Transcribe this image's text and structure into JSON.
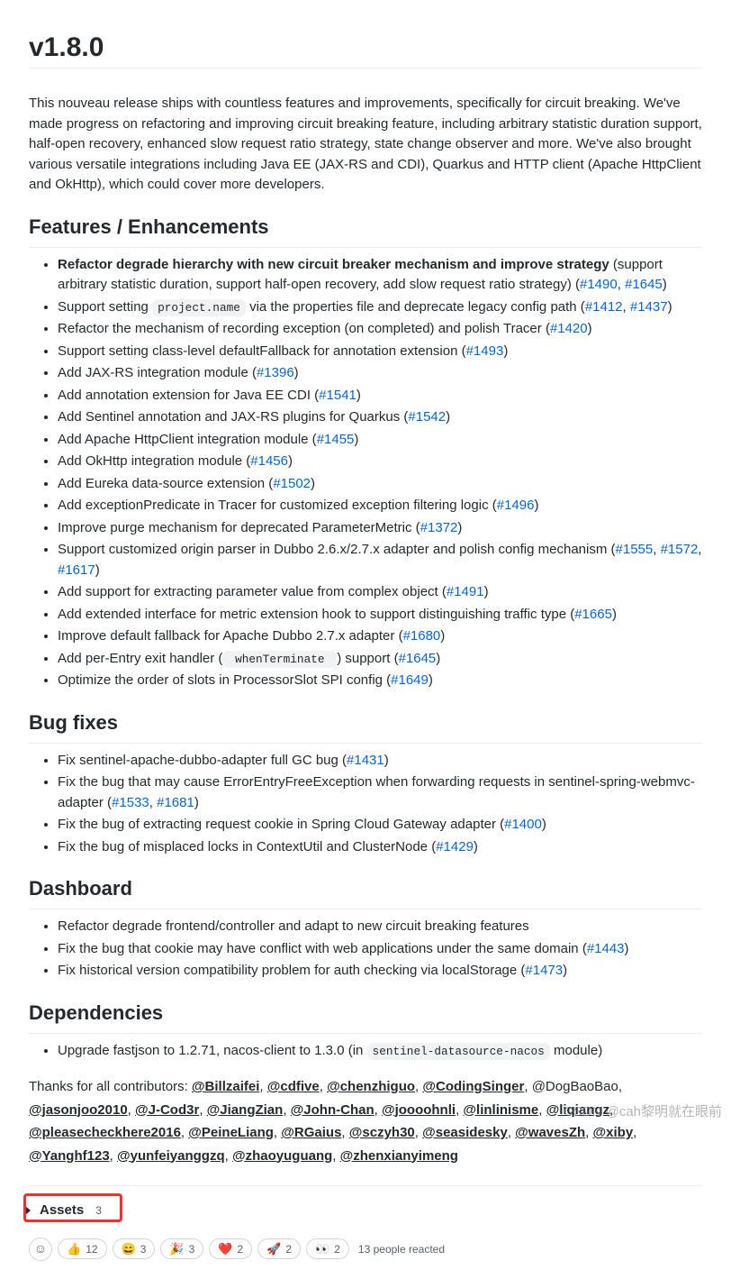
{
  "title": "v1.8.0",
  "intro": "This nouveau release ships with countless features and improvements, specifically for circuit breaking. We've made progress on refactoring and improving circuit breaking feature, including arbitrary statistic duration support, half-open recovery, enhanced slow request ratio strategy, state change observer and more. We've also brought various versatile integrations including Java EE (JAX-RS and CDI), Quarkus and HTTP client (Apache HttpClient and OkHttp), which could cover more developers.",
  "sections": {
    "features": {
      "heading": "Features / Enhancements",
      "items": [
        {
          "bold": "Refactor degrade hierarchy with new circuit breaker mechanism and improve strategy",
          "rest": " (support arbitrary statistic duration, support half-open recovery, add slow request ratio strategy) (",
          "links": [
            "#1490",
            "#1645"
          ],
          "tail": ")"
        },
        {
          "pre": "Support setting ",
          "code": "project.name",
          "rest": " via the properties file and deprecate legacy config path (",
          "links": [
            "#1412",
            "#1437"
          ],
          "tail": ")"
        },
        {
          "pre": "Refactor the mechanism of recording exception (on completed) and polish Tracer (",
          "links": [
            "#1420"
          ],
          "tail": ")"
        },
        {
          "pre": "Support setting class-level defaultFallback for annotation extension (",
          "links": [
            "#1493"
          ],
          "tail": ")"
        },
        {
          "pre": "Add JAX-RS integration module (",
          "links": [
            "#1396"
          ],
          "tail": ")"
        },
        {
          "pre": "Add annotation extension for Java EE CDI (",
          "links": [
            "#1541"
          ],
          "tail": ")"
        },
        {
          "pre": "Add Sentinel annotation and JAX-RS plugins for Quarkus (",
          "links": [
            "#1542"
          ],
          "tail": ")"
        },
        {
          "pre": "Add Apache HttpClient integration module (",
          "links": [
            "#1455"
          ],
          "tail": ")"
        },
        {
          "pre": "Add OkHttp integration module (",
          "links": [
            "#1456"
          ],
          "tail": ")"
        },
        {
          "pre": "Add Eureka data-source extension (",
          "links": [
            "#1502"
          ],
          "tail": ")"
        },
        {
          "pre": "Add exceptionPredicate in Tracer for customized exception filtering logic (",
          "links": [
            "#1496"
          ],
          "tail": ")"
        },
        {
          "pre": "Improve purge mechanism for deprecated ParameterMetric (",
          "links": [
            "#1372"
          ],
          "tail": ")"
        },
        {
          "pre": "Support customized origin parser in Dubbo 2.6.x/2.7.x adapter and polish config mechanism (",
          "links": [
            "#1555",
            "#1572",
            "#1617"
          ],
          "tail": ")"
        },
        {
          "pre": "Add support for extracting parameter value from complex object (",
          "links": [
            "#1491"
          ],
          "tail": ")"
        },
        {
          "pre": "Add extended interface for metric extension hook to support distinguishing traffic type (",
          "links": [
            "#1665"
          ],
          "tail": ")"
        },
        {
          "pre": "Improve default fallback for Apache Dubbo 2.7.x adapter (",
          "links": [
            "#1680"
          ],
          "tail": ")"
        },
        {
          "pre": "Add per-Entry exit handler (",
          "code": " whenTerminate ",
          "rest": ") support (",
          "links": [
            "#1645"
          ],
          "tail": ")"
        },
        {
          "pre": "Optimize the order of slots in ProcessorSlot SPI config (",
          "links": [
            "#1649"
          ],
          "tail": ")"
        }
      ]
    },
    "bugfixes": {
      "heading": "Bug fixes",
      "items": [
        {
          "pre": "Fix sentinel-apache-dubbo-adapter full GC bug (",
          "links": [
            "#1431"
          ],
          "tail": ")"
        },
        {
          "pre": "Fix the bug that may cause ErrorEntryFreeException when forwarding requests in sentinel-spring-webmvc-adapter (",
          "links": [
            "#1533",
            "#1681"
          ],
          "tail": ")"
        },
        {
          "pre": "Fix the bug of extracting request cookie in Spring Cloud Gateway adapter (",
          "links": [
            "#1400"
          ],
          "tail": ")"
        },
        {
          "pre": "Fix the bug of misplaced locks in ContextUtil and ClusterNode (",
          "links": [
            "#1429"
          ],
          "tail": ")"
        }
      ]
    },
    "dashboard": {
      "heading": "Dashboard",
      "items": [
        {
          "pre": "Refactor degrade frontend/controller and adapt to new circuit breaking features"
        },
        {
          "pre": "Fix the bug that cookie may have conflict with web applications under the same domain (",
          "links": [
            "#1443"
          ],
          "tail": ")"
        },
        {
          "pre": "Fix historical version compatibility problem for auth checking via localStorage (",
          "links": [
            "#1473"
          ],
          "tail": ")"
        }
      ]
    },
    "deps": {
      "heading": "Dependencies",
      "items": [
        {
          "pre": "Upgrade fastjson to 1.2.71, nacos-client to 1.3.0 (in ",
          "code": "sentinel-datasource-nacos",
          "rest": " module)"
        }
      ]
    }
  },
  "thanks": {
    "prefix": "Thanks for all contributors: ",
    "mentions": [
      "@Billzaifei",
      "@cdfive",
      "@chenzhiguo",
      "@CodingSinger",
      "@DogBaoBao",
      "@jasonjoo2010",
      "@J-Cod3r",
      "@JiangZian",
      "@John-Chan",
      "@joooohnli",
      "@linlinisme",
      "@liqiangz",
      "@pleasecheckhere2016",
      "@PeineLiang",
      "@RGaius",
      "@sczyh30",
      "@seasidesky",
      "@wavesZh",
      "@xiby",
      "@Yanghf123",
      "@yunfeiyanggzq",
      "@zhaoyuguang",
      "@zhenxianyimeng"
    ],
    "plain_index": 4
  },
  "assets": {
    "label": "Assets",
    "count": "3"
  },
  "reactions": {
    "items": [
      {
        "emoji": "👍",
        "count": "12"
      },
      {
        "emoji": "😄",
        "count": "3"
      },
      {
        "emoji": "🎉",
        "count": "3"
      },
      {
        "emoji": "❤️",
        "count": "2"
      },
      {
        "emoji": "🚀",
        "count": "2"
      },
      {
        "emoji": "👀",
        "count": "2"
      }
    ],
    "summary": "13 people reacted"
  },
  "watermark": "CSDN @cah黎明就在眼前"
}
